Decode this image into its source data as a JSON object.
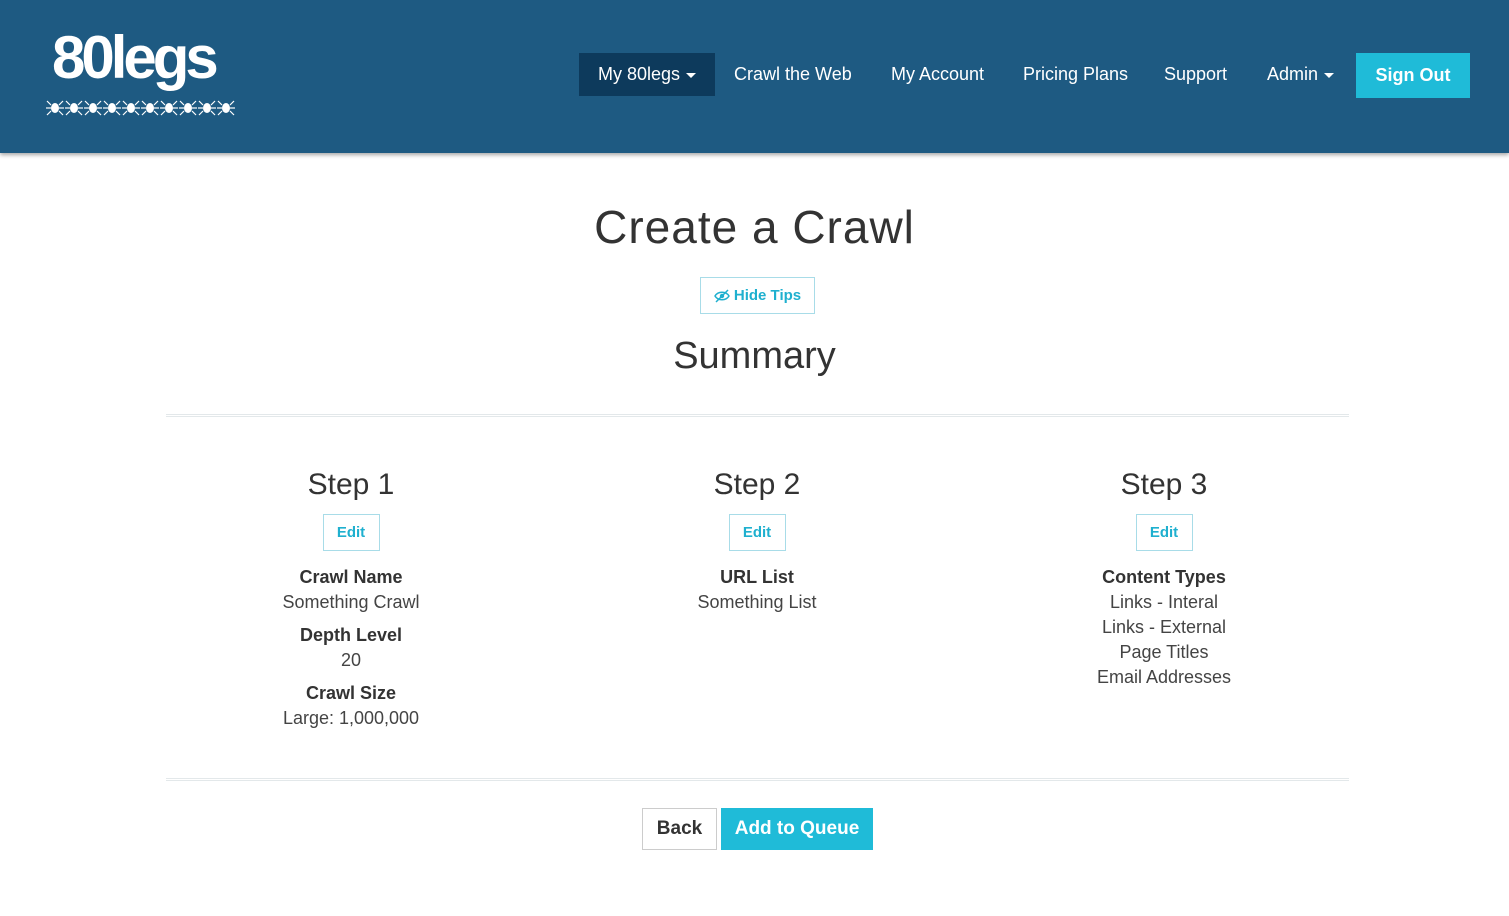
{
  "header": {
    "logo_text": "80legs",
    "nav": {
      "my80legs": "My 80legs",
      "crawl_the_web": "Crawl the Web",
      "my_account": "My Account",
      "pricing_plans": "Pricing Plans",
      "support": "Support",
      "admin": "Admin"
    },
    "sign_out": "Sign Out"
  },
  "main": {
    "title": "Create a Crawl",
    "hide_tips": "Hide Tips",
    "summary_title": "Summary",
    "steps": [
      {
        "title": "Step 1",
        "edit": "Edit",
        "fields": [
          {
            "label": "Crawl Name",
            "values": [
              "Something Crawl"
            ]
          },
          {
            "label": "Depth Level",
            "values": [
              "20"
            ]
          },
          {
            "label": "Crawl Size",
            "values": [
              "Large: 1,000,000"
            ]
          }
        ]
      },
      {
        "title": "Step 2",
        "edit": "Edit",
        "fields": [
          {
            "label": "URL List",
            "values": [
              "Something List"
            ]
          }
        ]
      },
      {
        "title": "Step 3",
        "edit": "Edit",
        "fields": [
          {
            "label": "Content Types",
            "values": [
              "Links - Interal",
              "Links - External",
              "Page Titles",
              "Email Addresses"
            ]
          }
        ]
      }
    ],
    "back": "Back",
    "add_to_queue": "Add to Queue"
  },
  "icons": {
    "logo_bugs": "spider-icon",
    "hide_tips": "eye-slash-icon",
    "dropdown": "caret-down-icon"
  },
  "colors": {
    "header_bg": "#1e5a82",
    "active_nav_bg": "#0d3a5c",
    "accent": "#1fbbd8"
  }
}
